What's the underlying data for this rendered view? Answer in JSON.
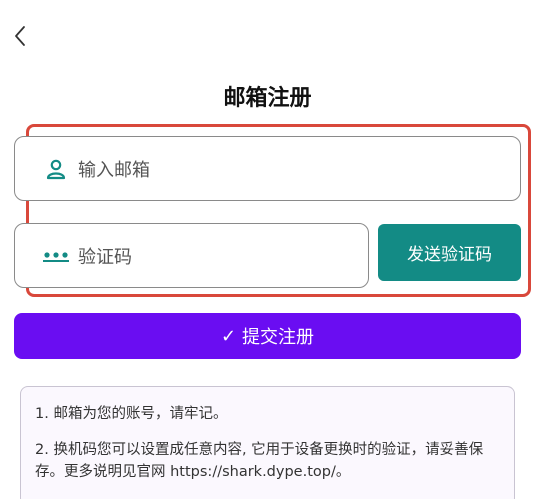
{
  "header": {
    "back_icon": "chevron-left-icon",
    "title": "邮箱注册"
  },
  "form": {
    "email": {
      "icon": "person-icon",
      "placeholder": "输入邮箱"
    },
    "code": {
      "icon": "password-dots-icon",
      "placeholder": "验证码"
    },
    "send_code_label": "发送验证码",
    "submit_check": "✓",
    "submit_label": "提交注册"
  },
  "notes": [
    "1. 邮箱为您的账号，请牢记。",
    "2. 换机码您可以设置成任意内容, 它用于设备更换时的验证，请妥善保存。更多说明见官网 https://shark.dype.top/。"
  ],
  "colors": {
    "accent_teal": "#138b85",
    "primary_purple": "#6a0df2",
    "highlight_red": "#d9483b"
  }
}
